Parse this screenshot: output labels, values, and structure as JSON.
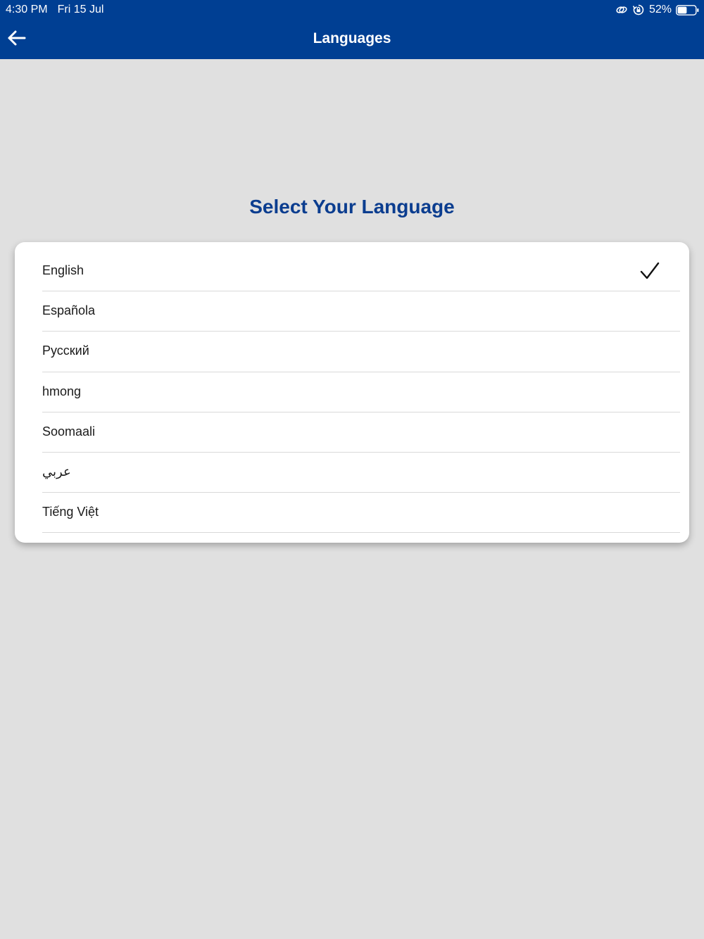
{
  "status_bar": {
    "time": "4:30 PM",
    "date": "Fri 15 Jul",
    "battery_percent": "52%",
    "battery_level": 0.52,
    "icons": [
      "link-icon",
      "orientation-lock-icon",
      "battery-icon"
    ]
  },
  "header": {
    "title": "Languages",
    "back_icon": "arrow-left-icon"
  },
  "main": {
    "heading": "Select Your Language",
    "languages": [
      {
        "label": "English",
        "selected": true
      },
      {
        "label": "Española",
        "selected": false
      },
      {
        "label": "Русский",
        "selected": false
      },
      {
        "label": "hmong",
        "selected": false
      },
      {
        "label": "Soomaali",
        "selected": false
      },
      {
        "label": "عربي",
        "selected": false
      },
      {
        "label": "Tiếng Việt",
        "selected": false
      }
    ],
    "selected_icon": "checkmark-icon"
  },
  "colors": {
    "app_bar": "#003f93",
    "heading": "#0b3d8f",
    "background": "#e0e0e0",
    "card": "#ffffff"
  }
}
